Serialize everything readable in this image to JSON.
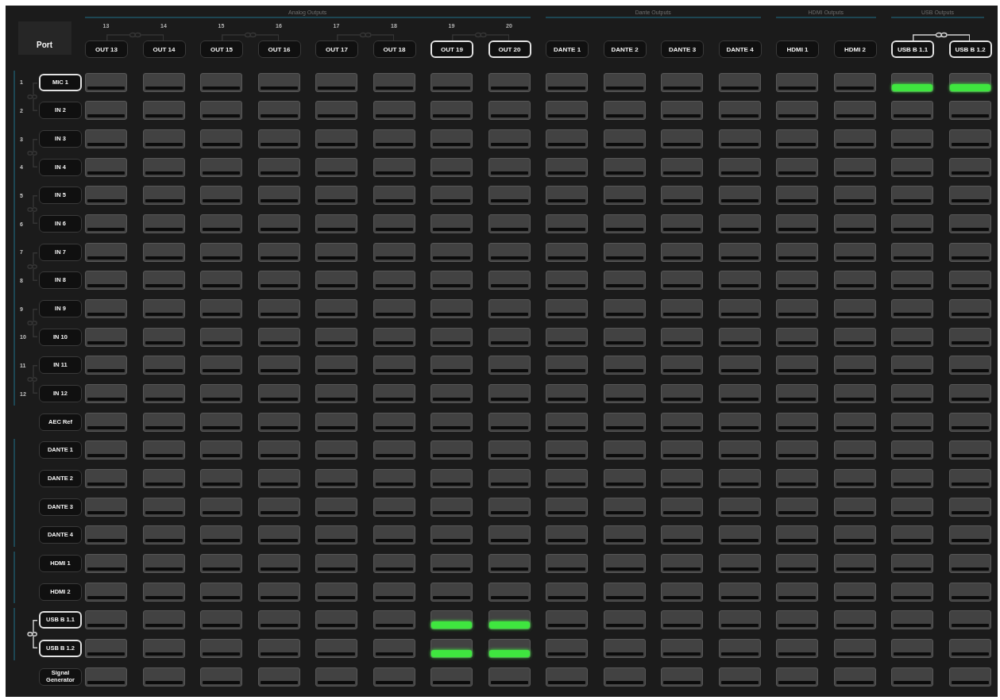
{
  "header": {
    "port_label": "Port"
  },
  "output_groups": [
    {
      "title": "Analog Outputs",
      "columns": [
        {
          "number": "13",
          "label": "OUT 13",
          "highlighted": false,
          "linkable": true,
          "linked": false
        },
        {
          "number": "14",
          "label": "OUT 14",
          "highlighted": false,
          "linkable": false,
          "linked": false
        },
        {
          "number": "15",
          "label": "OUT 15",
          "highlighted": false,
          "linkable": true,
          "linked": false
        },
        {
          "number": "16",
          "label": "OUT 16",
          "highlighted": false,
          "linkable": false,
          "linked": false
        },
        {
          "number": "17",
          "label": "OUT 17",
          "highlighted": false,
          "linkable": true,
          "linked": false
        },
        {
          "number": "18",
          "label": "OUT 18",
          "highlighted": false,
          "linkable": false,
          "linked": false
        },
        {
          "number": "19",
          "label": "OUT 19",
          "highlighted": true,
          "linkable": true,
          "linked": false
        },
        {
          "number": "20",
          "label": "OUT 20",
          "highlighted": true,
          "linkable": false,
          "linked": false
        }
      ]
    },
    {
      "title": "Dante Outputs",
      "columns": [
        {
          "label": "DANTE 1",
          "highlighted": false,
          "linkable": false,
          "linked": false
        },
        {
          "label": "DANTE 2",
          "highlighted": false,
          "linkable": false,
          "linked": false
        },
        {
          "label": "DANTE 3",
          "highlighted": false,
          "linkable": false,
          "linked": false
        },
        {
          "label": "DANTE 4",
          "highlighted": false,
          "linkable": false,
          "linked": false
        }
      ]
    },
    {
      "title": "HDMI Outputs",
      "columns": [
        {
          "label": "HDMI 1",
          "highlighted": false,
          "linkable": false,
          "linked": false
        },
        {
          "label": "HDMI 2",
          "highlighted": false,
          "linkable": false,
          "linked": false
        }
      ]
    },
    {
      "title": "USB Outputs",
      "columns": [
        {
          "label": "USB B 1.1",
          "highlighted": true,
          "linkable": true,
          "linked": true
        },
        {
          "label": "USB B 1.2",
          "highlighted": true,
          "linkable": false,
          "linked": false
        }
      ]
    }
  ],
  "input_groups": [
    {
      "kind": "bracketed",
      "rows": [
        {
          "number": "1",
          "label": "MIC 1",
          "highlighted": true,
          "linkable": true,
          "linked": false,
          "routes": [
            false,
            false,
            false,
            false,
            false,
            false,
            false,
            false,
            false,
            false,
            false,
            false,
            false,
            false,
            true,
            true
          ]
        },
        {
          "number": "2",
          "label": "IN 2",
          "highlighted": false,
          "linkable": false,
          "linked": false,
          "routes": [
            false,
            false,
            false,
            false,
            false,
            false,
            false,
            false,
            false,
            false,
            false,
            false,
            false,
            false,
            false,
            false
          ]
        },
        {
          "number": "3",
          "label": "IN 3",
          "highlighted": false,
          "linkable": true,
          "linked": false,
          "routes": [
            false,
            false,
            false,
            false,
            false,
            false,
            false,
            false,
            false,
            false,
            false,
            false,
            false,
            false,
            false,
            false
          ]
        },
        {
          "number": "4",
          "label": "IN 4",
          "highlighted": false,
          "linkable": false,
          "linked": false,
          "routes": [
            false,
            false,
            false,
            false,
            false,
            false,
            false,
            false,
            false,
            false,
            false,
            false,
            false,
            false,
            false,
            false
          ]
        },
        {
          "number": "5",
          "label": "IN 5",
          "highlighted": false,
          "linkable": true,
          "linked": false,
          "routes": [
            false,
            false,
            false,
            false,
            false,
            false,
            false,
            false,
            false,
            false,
            false,
            false,
            false,
            false,
            false,
            false
          ]
        },
        {
          "number": "6",
          "label": "IN 6",
          "highlighted": false,
          "linkable": false,
          "linked": false,
          "routes": [
            false,
            false,
            false,
            false,
            false,
            false,
            false,
            false,
            false,
            false,
            false,
            false,
            false,
            false,
            false,
            false
          ]
        },
        {
          "number": "7",
          "label": "IN 7",
          "highlighted": false,
          "linkable": true,
          "linked": false,
          "routes": [
            false,
            false,
            false,
            false,
            false,
            false,
            false,
            false,
            false,
            false,
            false,
            false,
            false,
            false,
            false,
            false
          ]
        },
        {
          "number": "8",
          "label": "IN 8",
          "highlighted": false,
          "linkable": false,
          "linked": false,
          "routes": [
            false,
            false,
            false,
            false,
            false,
            false,
            false,
            false,
            false,
            false,
            false,
            false,
            false,
            false,
            false,
            false
          ]
        },
        {
          "number": "9",
          "label": "IN 9",
          "highlighted": false,
          "linkable": true,
          "linked": false,
          "routes": [
            false,
            false,
            false,
            false,
            false,
            false,
            false,
            false,
            false,
            false,
            false,
            false,
            false,
            false,
            false,
            false
          ]
        },
        {
          "number": "10",
          "label": "IN 10",
          "highlighted": false,
          "linkable": false,
          "linked": false,
          "routes": [
            false,
            false,
            false,
            false,
            false,
            false,
            false,
            false,
            false,
            false,
            false,
            false,
            false,
            false,
            false,
            false
          ]
        },
        {
          "number": "11",
          "label": "IN 11",
          "highlighted": false,
          "linkable": true,
          "linked": false,
          "routes": [
            false,
            false,
            false,
            false,
            false,
            false,
            false,
            false,
            false,
            false,
            false,
            false,
            false,
            false,
            false,
            false
          ]
        },
        {
          "number": "12",
          "label": "IN 12",
          "highlighted": false,
          "linkable": false,
          "linked": false,
          "routes": [
            false,
            false,
            false,
            false,
            false,
            false,
            false,
            false,
            false,
            false,
            false,
            false,
            false,
            false,
            false,
            false
          ]
        }
      ]
    },
    {
      "kind": "plain",
      "rows": [
        {
          "label": "AEC Ref",
          "highlighted": false,
          "linkable": false,
          "linked": false,
          "routes": [
            false,
            false,
            false,
            false,
            false,
            false,
            false,
            false,
            false,
            false,
            false,
            false,
            false,
            false,
            false,
            false
          ]
        }
      ]
    },
    {
      "kind": "bracketed",
      "rows": [
        {
          "label": "DANTE 1",
          "highlighted": false,
          "linkable": false,
          "linked": false,
          "routes": [
            false,
            false,
            false,
            false,
            false,
            false,
            false,
            false,
            false,
            false,
            false,
            false,
            false,
            false,
            false,
            false
          ]
        },
        {
          "label": "DANTE 2",
          "highlighted": false,
          "linkable": false,
          "linked": false,
          "routes": [
            false,
            false,
            false,
            false,
            false,
            false,
            false,
            false,
            false,
            false,
            false,
            false,
            false,
            false,
            false,
            false
          ]
        },
        {
          "label": "DANTE 3",
          "highlighted": false,
          "linkable": false,
          "linked": false,
          "routes": [
            false,
            false,
            false,
            false,
            false,
            false,
            false,
            false,
            false,
            false,
            false,
            false,
            false,
            false,
            false,
            false
          ]
        },
        {
          "label": "DANTE 4",
          "highlighted": false,
          "linkable": false,
          "linked": false,
          "routes": [
            false,
            false,
            false,
            false,
            false,
            false,
            false,
            false,
            false,
            false,
            false,
            false,
            false,
            false,
            false,
            false
          ]
        }
      ]
    },
    {
      "kind": "bracketed",
      "rows": [
        {
          "label": "HDMI 1",
          "highlighted": false,
          "linkable": false,
          "linked": false,
          "routes": [
            false,
            false,
            false,
            false,
            false,
            false,
            false,
            false,
            false,
            false,
            false,
            false,
            false,
            false,
            false,
            false
          ]
        },
        {
          "label": "HDMI 2",
          "highlighted": false,
          "linkable": false,
          "linked": false,
          "routes": [
            false,
            false,
            false,
            false,
            false,
            false,
            false,
            false,
            false,
            false,
            false,
            false,
            false,
            false,
            false,
            false
          ]
        }
      ]
    },
    {
      "kind": "bracketed",
      "rows": [
        {
          "label": "USB B 1.1",
          "highlighted": true,
          "linkable": true,
          "linked": true,
          "routes": [
            false,
            false,
            false,
            false,
            false,
            false,
            true,
            true,
            false,
            false,
            false,
            false,
            false,
            false,
            false,
            false
          ]
        },
        {
          "label": "USB B 1.2",
          "highlighted": true,
          "linkable": false,
          "linked": false,
          "routes": [
            false,
            false,
            false,
            false,
            false,
            false,
            true,
            true,
            false,
            false,
            false,
            false,
            false,
            false,
            false,
            false
          ]
        }
      ]
    },
    {
      "kind": "plain",
      "rows": [
        {
          "label": "Signal Generator",
          "highlighted": false,
          "linkable": false,
          "linked": false,
          "routes": [
            false,
            false,
            false,
            false,
            false,
            false,
            false,
            false,
            false,
            false,
            false,
            false,
            false,
            false,
            false,
            false
          ]
        }
      ]
    }
  ]
}
